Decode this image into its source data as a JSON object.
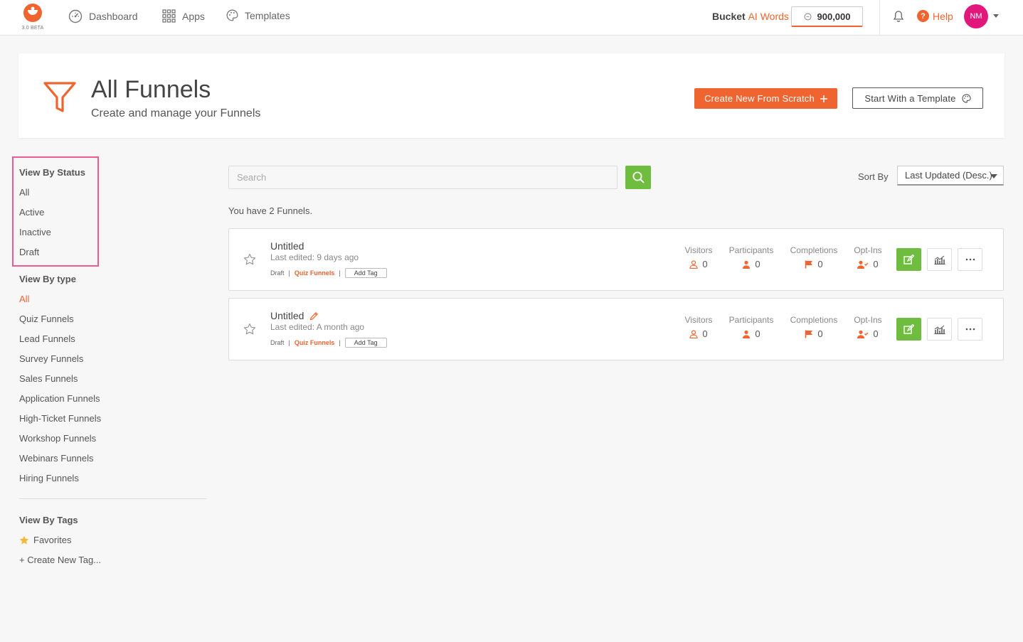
{
  "nav": {
    "logo_badge": "3.0 BETA",
    "items": [
      {
        "label": "Dashboard",
        "icon": "dashboard-gauge-icon"
      },
      {
        "label": "Apps",
        "icon": "apps-grid-icon"
      },
      {
        "label": "Templates",
        "icon": "palette-icon"
      }
    ],
    "bucket_label": "Bucket",
    "ai_words_label": "AI Words",
    "credits": "900,000",
    "help_label": "Help",
    "avatar_initials": "NM"
  },
  "header": {
    "title": "All Funnels",
    "subtitle": "Create and manage your Funnels",
    "create_button": "Create New From Scratch",
    "template_button": "Start With a Template"
  },
  "sidebar": {
    "status_heading": "View By Status",
    "status_items": [
      "All",
      "Active",
      "Inactive",
      "Draft"
    ],
    "type_heading": "View By type",
    "type_items": [
      "All",
      "Quiz Funnels",
      "Lead Funnels",
      "Survey Funnels",
      "Sales Funnels",
      "Application Funnels",
      "High-Ticket Funnels",
      "Workshop Funnels",
      "Webinars Funnels",
      "Hiring Funnels"
    ],
    "active_type": "All",
    "tags_heading": "View By Tags",
    "favorites_label": "Favorites",
    "create_tag_label": "+ Create New Tag..."
  },
  "toolbar": {
    "search_placeholder": "Search",
    "sort_label": "Sort By",
    "sort_value": "Last Updated (Desc.)"
  },
  "summary": "You have 2 Funnels.",
  "funnels": [
    {
      "name": "Untitled",
      "edited": "Last edited: 9 days ago",
      "status": "Draft",
      "type": "Quiz Funnels",
      "add_tag": "Add Tag",
      "stats": [
        {
          "label": "Visitors",
          "value": "0"
        },
        {
          "label": "Participants",
          "value": "0"
        },
        {
          "label": "Completions",
          "value": "0"
        },
        {
          "label": "Opt-Ins",
          "value": "0"
        }
      ]
    },
    {
      "name": "Untitled",
      "edited": "Last edited: A month ago",
      "status": "Draft",
      "type": "Quiz Funnels",
      "add_tag": "Add Tag",
      "stats": [
        {
          "label": "Visitors",
          "value": "0"
        },
        {
          "label": "Participants",
          "value": "0"
        },
        {
          "label": "Completions",
          "value": "0"
        },
        {
          "label": "Opt-Ins",
          "value": "0"
        }
      ]
    }
  ],
  "colors": {
    "brand_orange": "#f0642f",
    "action_green": "#6fbd3e",
    "highlight_pink": "#ef5b91",
    "avatar_magenta": "#e2177c"
  }
}
